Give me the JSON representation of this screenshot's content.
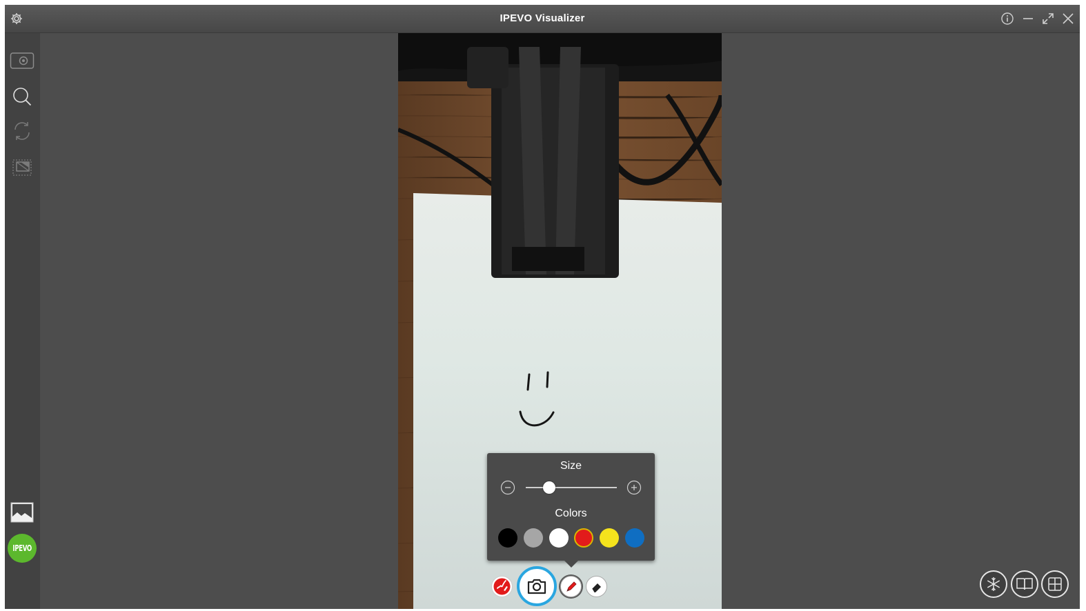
{
  "window": {
    "title": "IPEVO Visualizer"
  },
  "sidebar": {
    "logo_text": "IPEVO"
  },
  "popup": {
    "size_label": "Size",
    "size_level": 0.26,
    "colors_label": "Colors",
    "colors": [
      "#000000",
      "#a6a6a6",
      "#ffffff",
      "#e21b1b",
      "#f5e31d",
      "#0f6ec2"
    ],
    "selected_color": "#e21b1b"
  },
  "colors": {
    "accent": "#2aa6e0",
    "logo_green": "#5cb82d",
    "annotation_red": "#e21b1b"
  }
}
